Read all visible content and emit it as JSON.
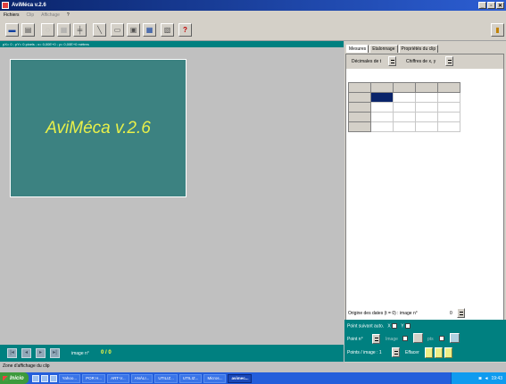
{
  "window": {
    "title": "AviMéca v.2.6",
    "controls": [
      "_",
      "▫",
      "✕"
    ]
  },
  "menu": {
    "items": [
      "Fichiers",
      "Clip",
      "Affichage",
      "?"
    ]
  },
  "toolbar": {
    "help_label": "?"
  },
  "status_strip": {
    "text": "pX= 0 ; pY= 0 pixels ; x= 0,00E+0 ; y= 0,00E+0 mètres"
  },
  "clip": {
    "title": "AviMéca v.2.6"
  },
  "navigation": {
    "image_label": "image n°",
    "image_value": "0 / 0"
  },
  "zone_label": "Zone d'affichage du clip",
  "tabs": [
    {
      "label": "Mesures"
    },
    {
      "label": "Etalonnage"
    },
    {
      "label": "Propriétés du clip"
    }
  ],
  "mesures": {
    "decimales_label": "Décimales de t",
    "chiffres_label": "Chiffres de x, y",
    "origin_label": "Origine des dates (t = 0) : image n°",
    "origin_value": "0",
    "point_suivant_label": "Point suivant auto.",
    "x_label": "X",
    "y_label": "Y",
    "point_label": "Point n°",
    "image_check_label": "Image",
    "pts_label": "pts",
    "points_image_label": "Points / image :",
    "points_image_value": "1",
    "effacer_label": "Effacer"
  },
  "taskbar": {
    "start_label": "Inicio",
    "tasks": [
      "Yahoo...",
      "POR H...",
      "ART-V...",
      "ANÁLI...",
      "UTILIZ...",
      "UTILIZ...",
      "Micros...",
      "avimec..."
    ],
    "clock": "19:43"
  },
  "colors": {
    "teal": "#008080",
    "clip_background": "#3c8281",
    "clip_title": "#e8f04a",
    "title_bar": "#0a246a"
  }
}
